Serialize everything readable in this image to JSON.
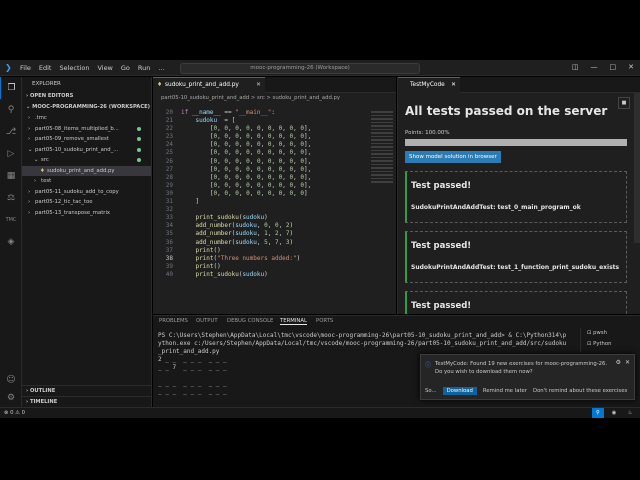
{
  "window": {
    "title": "mooc-programming-26 (Workspace)",
    "menu": [
      "File",
      "Edit",
      "Selection",
      "View",
      "Go",
      "Run",
      "…"
    ]
  },
  "sidebar": {
    "header": "EXPLORER",
    "open_editors": "OPEN EDITORS",
    "workspace": "MOOC-PROGRAMMING-26 (WORKSPACE)",
    "items": [
      {
        "label": ".tmc",
        "indent": 1,
        "arrow": "›"
      },
      {
        "label": "part05-08_items_multiplied_b...",
        "indent": 1,
        "arrow": "›",
        "dot": true
      },
      {
        "label": "part05-09_remove_smallest",
        "indent": 1,
        "arrow": "›",
        "dot": true
      },
      {
        "label": "part05-10_sudoku_print_and_...",
        "indent": 1,
        "arrow": "⌄",
        "dot": true
      },
      {
        "label": "src",
        "indent": 2,
        "arrow": "⌄",
        "dot": true
      },
      {
        "label": "sudoku_print_and_add.py",
        "indent": 3,
        "arrow": "",
        "selected": true
      },
      {
        "label": "test",
        "indent": 2,
        "arrow": "›"
      },
      {
        "label": "part05-11_sudoku_add_to_copy",
        "indent": 1,
        "arrow": "›"
      },
      {
        "label": "part05-12_tic_tac_toe",
        "indent": 1,
        "arrow": "›"
      },
      {
        "label": "part05-13_transpose_matrix",
        "indent": 1,
        "arrow": "›"
      }
    ],
    "outline": "OUTLINE",
    "timeline": "TIMELINE"
  },
  "editor": {
    "tab_label": "sudoku_print_and_add.py",
    "breadcrumbs": "part05-10_sudoku_print_and_add > src > sudoku_print_and_add.py",
    "lines": [
      {
        "no": "20",
        "code": "if __name__ == \"__main__\":"
      },
      {
        "no": "21",
        "code": "    sudoku  = ["
      },
      {
        "no": "22",
        "code": "        [0, 0, 0, 0, 0, 0, 0, 0, 0],"
      },
      {
        "no": "23",
        "code": "        [0, 0, 0, 0, 0, 0, 0, 0, 0],"
      },
      {
        "no": "24",
        "code": "        [0, 0, 0, 0, 0, 0, 0, 0, 0],"
      },
      {
        "no": "25",
        "code": "        [0, 0, 0, 0, 0, 0, 0, 0, 0],"
      },
      {
        "no": "26",
        "code": "        [0, 0, 0, 0, 0, 0, 0, 0, 0],"
      },
      {
        "no": "27",
        "code": "        [0, 0, 0, 0, 0, 0, 0, 0, 0],"
      },
      {
        "no": "28",
        "code": "        [0, 0, 0, 0, 0, 0, 0, 0, 0],"
      },
      {
        "no": "29",
        "code": "        [0, 0, 0, 0, 0, 0, 0, 0, 0],"
      },
      {
        "no": "30",
        "code": "        [0, 0, 0, 0, 0, 0, 0, 0, 0]"
      },
      {
        "no": "31",
        "code": "    ]"
      },
      {
        "no": "32",
        "code": ""
      },
      {
        "no": "33",
        "code": "    print_sudoku(sudoku)"
      },
      {
        "no": "34",
        "code": "    add_number(sudoku, 0, 0, 2)"
      },
      {
        "no": "35",
        "code": "    add_number(sudoku, 1, 2, 7)"
      },
      {
        "no": "36",
        "code": "    add_number(sudoku, 5, 7, 3)"
      },
      {
        "no": "37",
        "code": "    print()"
      },
      {
        "no": "38",
        "code": "    print(\"Three numbers added:\")",
        "current": true
      },
      {
        "no": "39",
        "code": "    print()"
      },
      {
        "no": "40",
        "code": "    print_sudoku(sudoku)"
      }
    ]
  },
  "testpanel": {
    "tab_label": "TestMyCode",
    "heading": "All tests passed on the server",
    "points_label": "Points: 100.00%",
    "progress": 1.0,
    "solution_button": "Show model solution in browser",
    "results": [
      {
        "status": "Test passed!",
        "name": "SudokuPrintAndAddTest: test_0_main_program_ok"
      },
      {
        "status": "Test passed!",
        "name": "SudokuPrintAndAddTest: test_1_function_print_sudoku_exists"
      },
      {
        "status": "Test passed!",
        "name": ""
      }
    ]
  },
  "bottom_panel": {
    "tabs": [
      "PROBLEMS",
      "OUTPUT",
      "DEBUG CONSOLE",
      "TERMINAL",
      "PORTS"
    ],
    "active_tab": "TERMINAL",
    "terminal_lines": [
      "PS C:\\Users\\Stephen\\AppData\\Local\\tmc\\vscode\\mooc-programming-26\\part05-10_sudoku_print_and_add> & C:\\Python314\\p",
      "ython.exe c:/Users/Stephen/AppData/Local/tmc/vscode/mooc-programming-26/part05-10_sudoku_print_and_add/src/sudoku",
      "_print_and_add.py",
      "2 _ _  _ _ _  _ _ _",
      "_ _ 7  _ _ _  _ _ _",
      "",
      "_ _ _  _ _ _  _ _ _",
      "_ _ _  _ _ _  _ _ _"
    ],
    "terminal_list": [
      "pwsh",
      "Python"
    ]
  },
  "notification": {
    "text": "TestMyCode: Found 19 new exercises for mooc-programming-26. Do you wish to download them now?",
    "actions": [
      "So...",
      "Download",
      "Remind me later",
      "Don't remind about these exercises"
    ]
  },
  "status": {
    "problems": "⊗ 0 ⚠ 0"
  }
}
